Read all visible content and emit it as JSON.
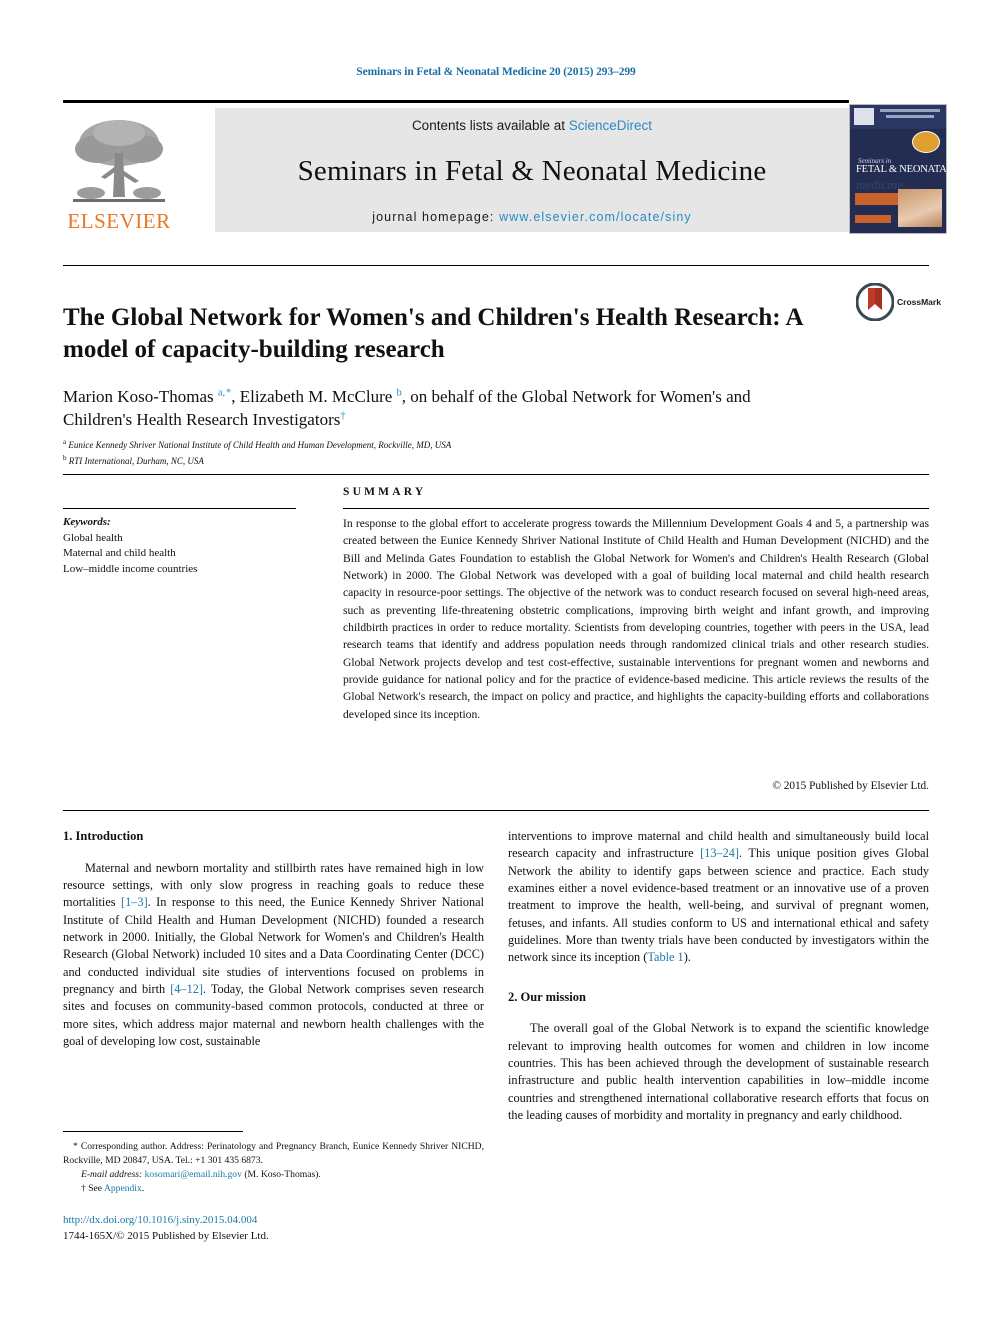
{
  "running_head": "Seminars in Fetal & Neonatal Medicine 20 (2015) 293–299",
  "header": {
    "publisher_logo_label": "ELSEVIER",
    "contents_prefix": "Contents lists available at ",
    "contents_link": "ScienceDirect",
    "journal_title": "Seminars in Fetal & Neonatal Medicine",
    "homepage_prefix": "journal homepage: ",
    "homepage_link": "www.elsevier.com/locate/siny",
    "cover": {
      "script_line": "Seminars in",
      "main_line": "FETAL & NEONATAL",
      "ghost_line": "medicine"
    }
  },
  "article": {
    "title": "The Global Network for Women's and Children's Health Research: A model of capacity-building research",
    "authors_html": "Marion Koso-Thomas <sup>a,&#8202;*</sup>, Elizabeth M. McClure <sup>b</sup>, on behalf of the Global Network for Women's and Children's Health Research Investigators<sup>&#8224;</sup>",
    "affiliation_a": "Eunice Kennedy Shriver National Institute of Child Health and Human Development, Rockville, MD, USA",
    "affiliation_b": "RTI International, Durham, NC, USA",
    "crossmark_label": "CrossMark"
  },
  "keywords": {
    "heading": "Keywords:",
    "items": [
      "Global health",
      "Maternal and child health",
      "Low–middle income countries"
    ]
  },
  "summary": {
    "heading": "SUMMARY",
    "body": "In response to the global effort to accelerate progress towards the Millennium Development Goals 4 and 5, a partnership was created between the Eunice Kennedy Shriver National Institute of Child Health and Human Development (NICHD) and the Bill and Melinda Gates Foundation to establish the Global Network for Women's and Children's Health Research (Global Network) in 2000. The Global Network was developed with a goal of building local maternal and child health research capacity in resource-poor settings. The objective of the network was to conduct research focused on several high-need areas, such as preventing life-threatening obstetric complications, improving birth weight and infant growth, and improving childbirth practices in order to reduce mortality. Scientists from developing countries, together with peers in the USA, lead research teams that identify and address population needs through randomized clinical trials and other research studies. Global Network projects develop and test cost-effective, sustainable interventions for pregnant women and newborns and provide guidance for national policy and for the practice of evidence-based medicine. This article reviews the results of the Global Network's research, the impact on policy and practice, and highlights the capacity-building efforts and collaborations developed since its inception.",
    "copyright": "© 2015 Published by Elsevier Ltd."
  },
  "body": {
    "section1_heading": "1. Introduction",
    "section1_para_html": "Maternal and newborn mortality and stillbirth rates have remained high in low resource settings, with only slow progress in reaching goals to reduce these mortalities <span class=\"link\">[1–3]</span>. In response to this need, the Eunice Kennedy Shriver National Institute of Child Health and Human Development (NICHD) founded a research network in 2000. Initially, the Global Network for Women's and Children's Health Research (Global Network) included 10 sites and a Data Coordinating Center (DCC) and conducted individual site studies of interventions focused on problems in pregnancy and birth <span class=\"link\">[4–12]</span>. Today, the Global Network comprises seven research sites and focuses on community-based common protocols, conducted at three or more sites, which address major maternal and newborn health challenges with the goal of developing low cost, sustainable",
    "section1_cont_html": "interventions to improve maternal and child health and simultaneously build local research capacity and infrastructure <span class=\"link\">[13–24]</span>. This unique position gives Global Network the ability to identify gaps between science and practice. Each study examines either a novel evidence-based treatment or an innovative use of a proven treatment to improve the health, well-being, and survival of pregnant women, fetuses, and infants. All studies conform to US and international ethical and safety guidelines. More than twenty trials have been conducted by investigators within the network since its inception (<span class=\"link\">Table 1</span>).",
    "section2_heading": "2. Our mission",
    "section2_para": "The overall goal of the Global Network is to expand the scientific knowledge relevant to improving health outcomes for women and children in low income countries. This has been achieved through the development of sustainable research infrastructure and public health intervention capabilities in low–middle income countries and strengthened international collaborative research efforts that focus on the leading causes of morbidity and mortality in pregnancy and early childhood."
  },
  "footnotes": {
    "corresponding_html": "* Corresponding author. Address: Perinatology and Pregnancy Branch, Eunice Kennedy Shriver NICHD, Rockville, MD 20847, USA. Tel.: +1 301 435 6873.",
    "email_label": "E-mail address:",
    "email_value": "kosomari@email.nih.gov",
    "email_suffix": "(M. Koso-Thomas).",
    "appendix_dagger": "†",
    "appendix_prefix": "See ",
    "appendix_link": "Appendix",
    "appendix_suffix": "."
  },
  "imprint": {
    "doi": "http://dx.doi.org/10.1016/j.siny.2015.04.004",
    "issn_line": "1744-165X/© 2015 Published by Elsevier Ltd."
  },
  "colors": {
    "link_blue": "#2a8bc4",
    "ref_blue": "#1a7aa8",
    "elsevier_orange": "#E87722",
    "header_band": "#e6e6e6",
    "cover_navy": "#232d52"
  }
}
